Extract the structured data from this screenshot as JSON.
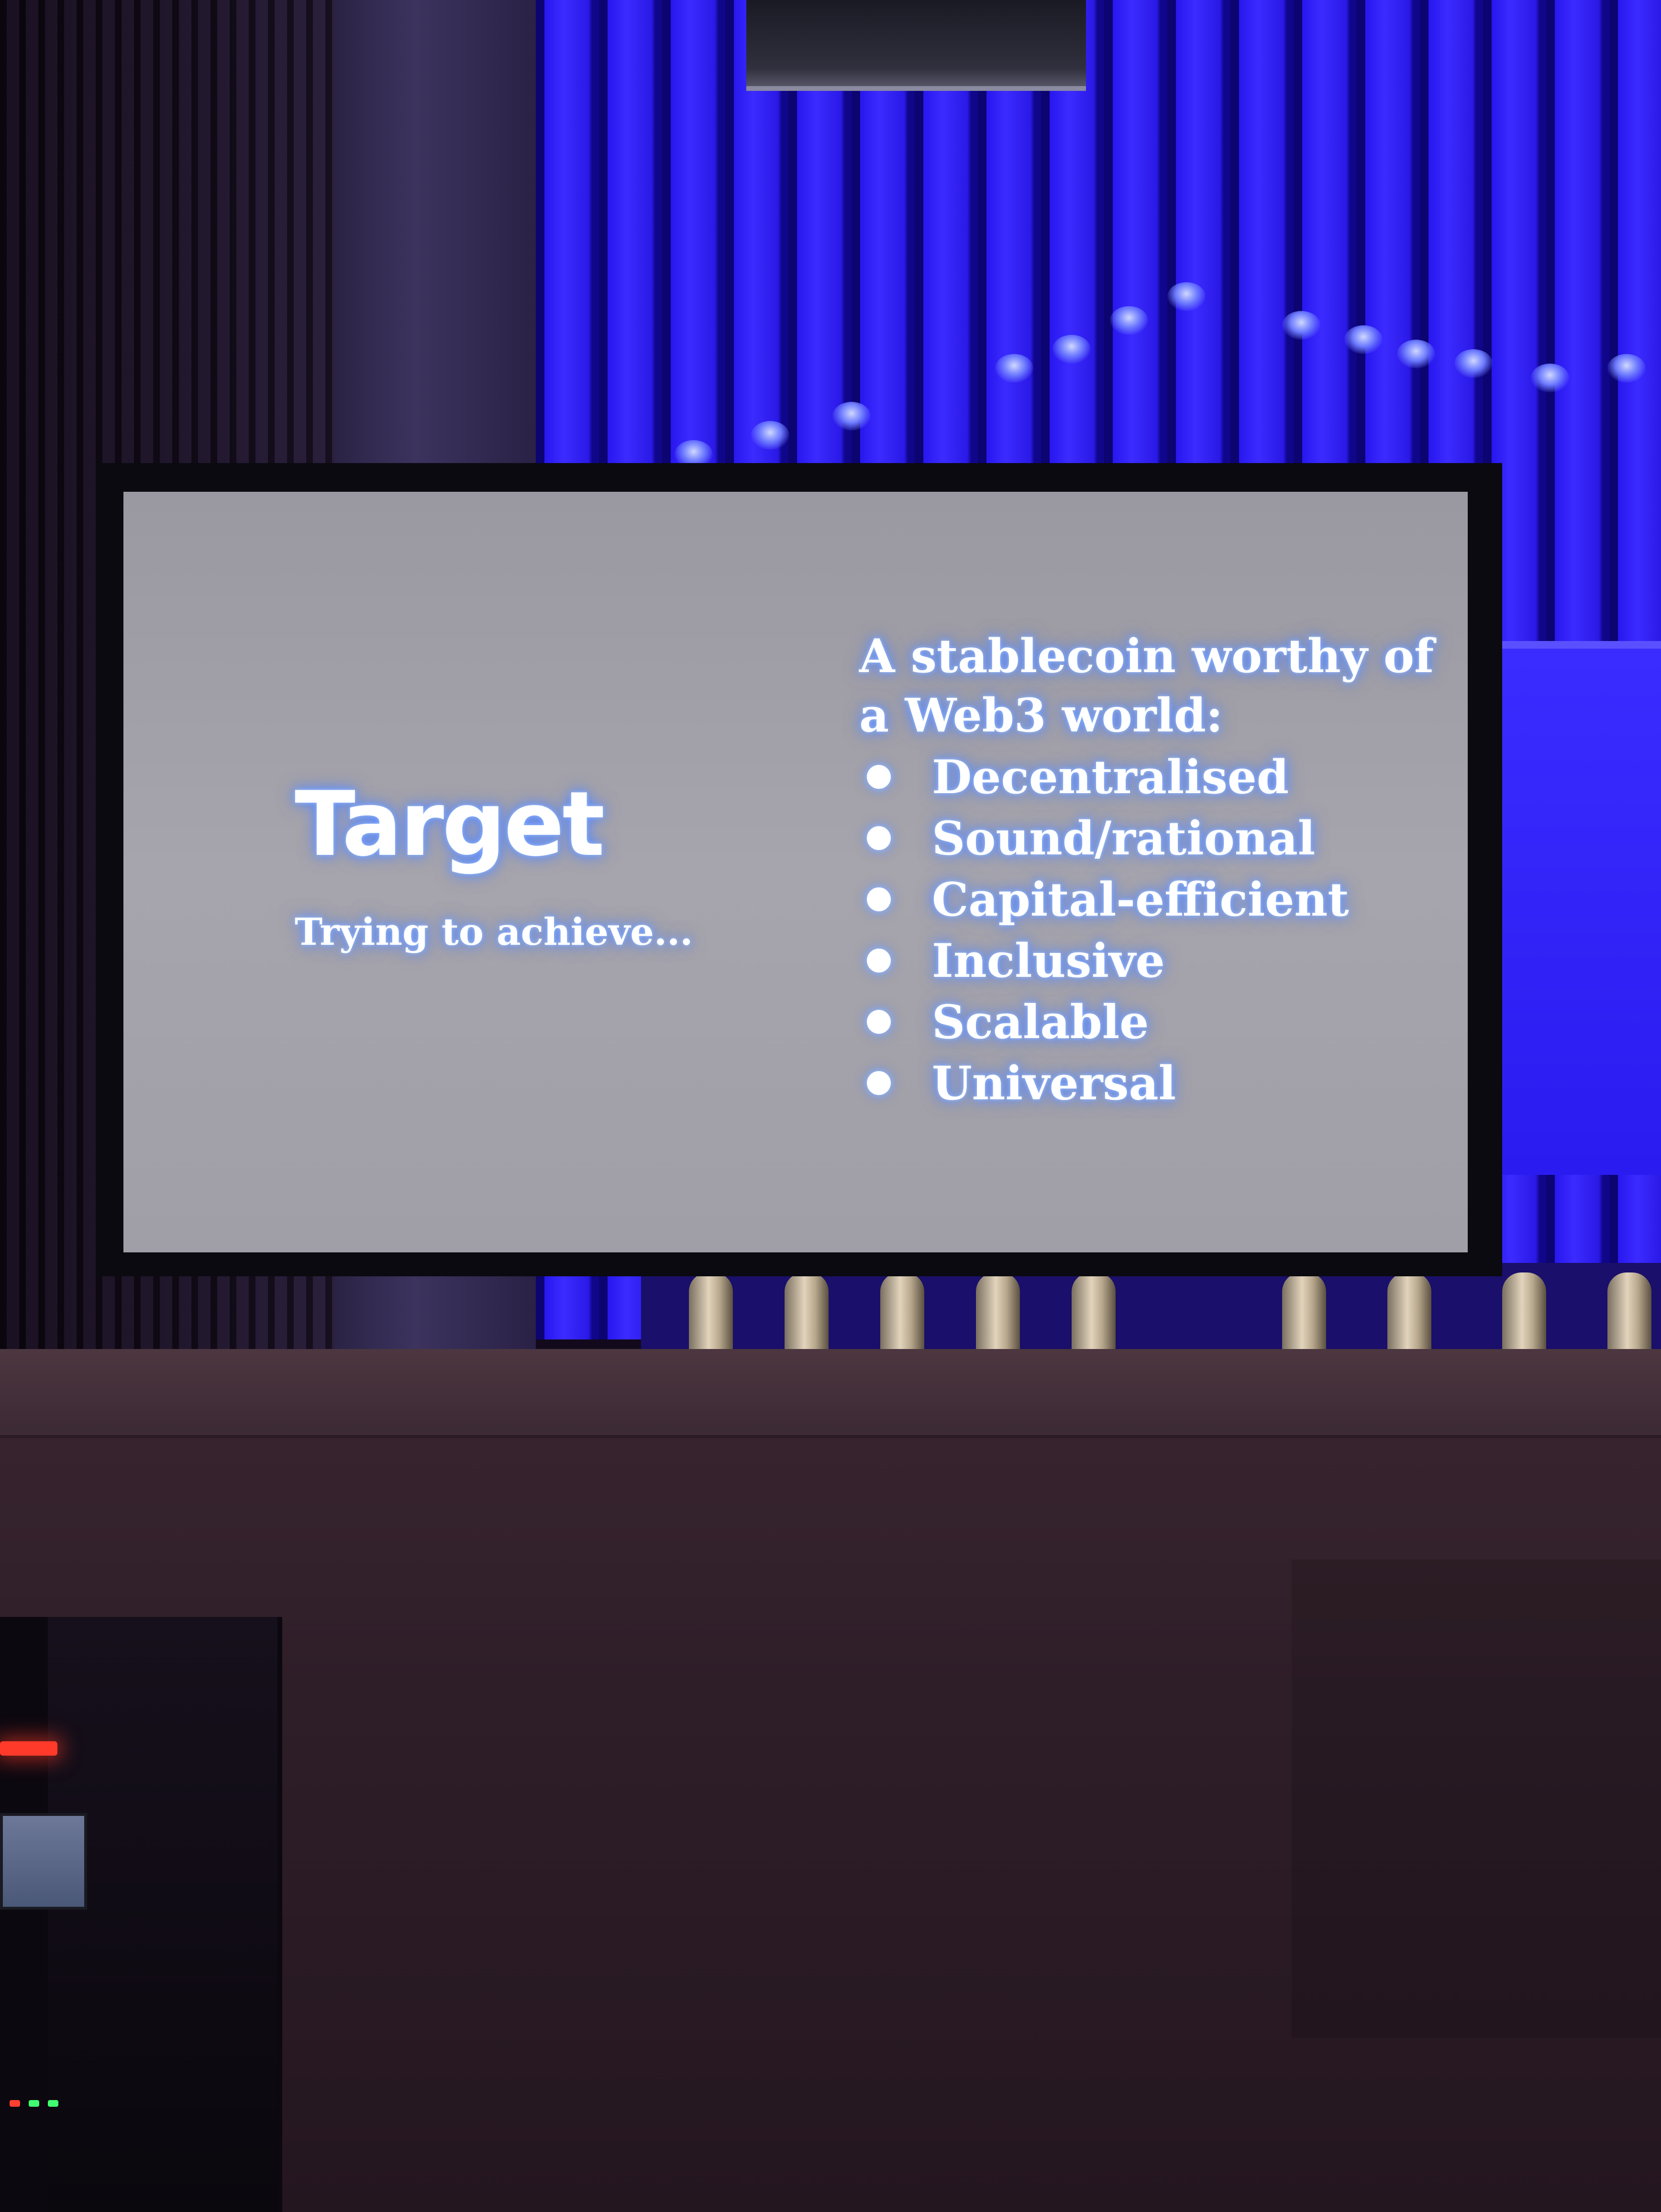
{
  "slide": {
    "title": "Target",
    "subtitle": "Trying to achieve...",
    "heading": "A stablecoin worthy of a Web3 world:",
    "items": [
      "Decentralised",
      "Sound/rational",
      "Capital-efficient",
      "Inclusive",
      "Scalable",
      "Universal"
    ]
  },
  "colors": {
    "organ_light": "#2a19e6",
    "screen": "#a6a4ac",
    "text_glow": "#5e8dff"
  }
}
